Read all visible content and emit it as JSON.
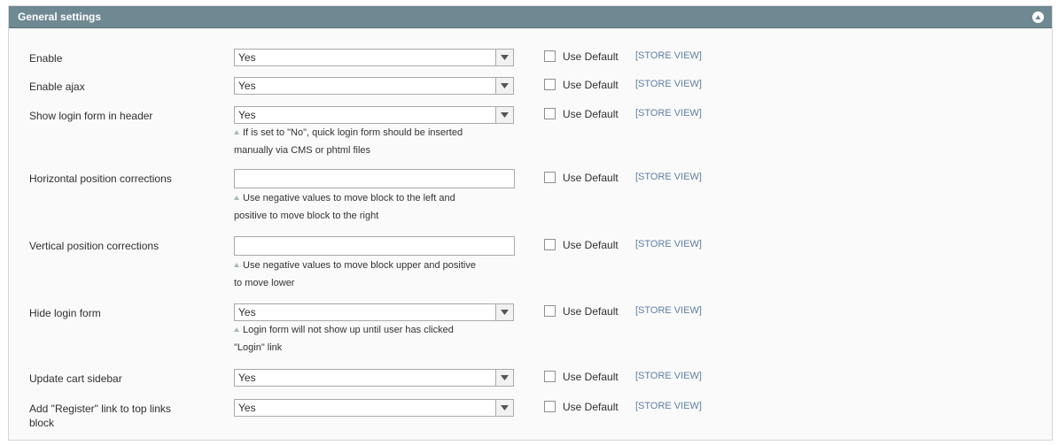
{
  "section": {
    "title": "General settings",
    "collapse_icon": "chevron-up-circle-icon",
    "header_color": "#6f8992"
  },
  "use_default_label": "Use Default",
  "scope_label": "[STORE VIEW]",
  "scope_color": "#5f7fa3",
  "fields": [
    {
      "label": "Enable",
      "type": "select",
      "value": "Yes"
    },
    {
      "label": "Enable ajax",
      "type": "select",
      "value": "Yes"
    },
    {
      "label": "Show login form in header",
      "type": "select",
      "value": "Yes",
      "note_lines": [
        "If is set to \"No\", quick login form should be inserted",
        "manually via CMS or phtml files"
      ]
    },
    {
      "label": "Horizontal position corrections",
      "type": "text",
      "value": "",
      "note_lines": [
        "Use negative values to move block to the left and",
        "positive to move block to the right"
      ]
    },
    {
      "label": "Vertical position corrections",
      "type": "text",
      "value": "",
      "note_lines": [
        "Use negative values to move block upper and positive",
        "to move lower"
      ]
    },
    {
      "label": "Hide login form",
      "type": "select",
      "value": "Yes",
      "note_lines": [
        "Login form will not show up until user has clicked",
        "\"Login\" link"
      ]
    },
    {
      "label": "Update cart sidebar",
      "type": "select",
      "value": "Yes"
    },
    {
      "label_lines": [
        "Add \"Register\" link to top links",
        "block"
      ],
      "type": "select",
      "value": "Yes"
    }
  ]
}
